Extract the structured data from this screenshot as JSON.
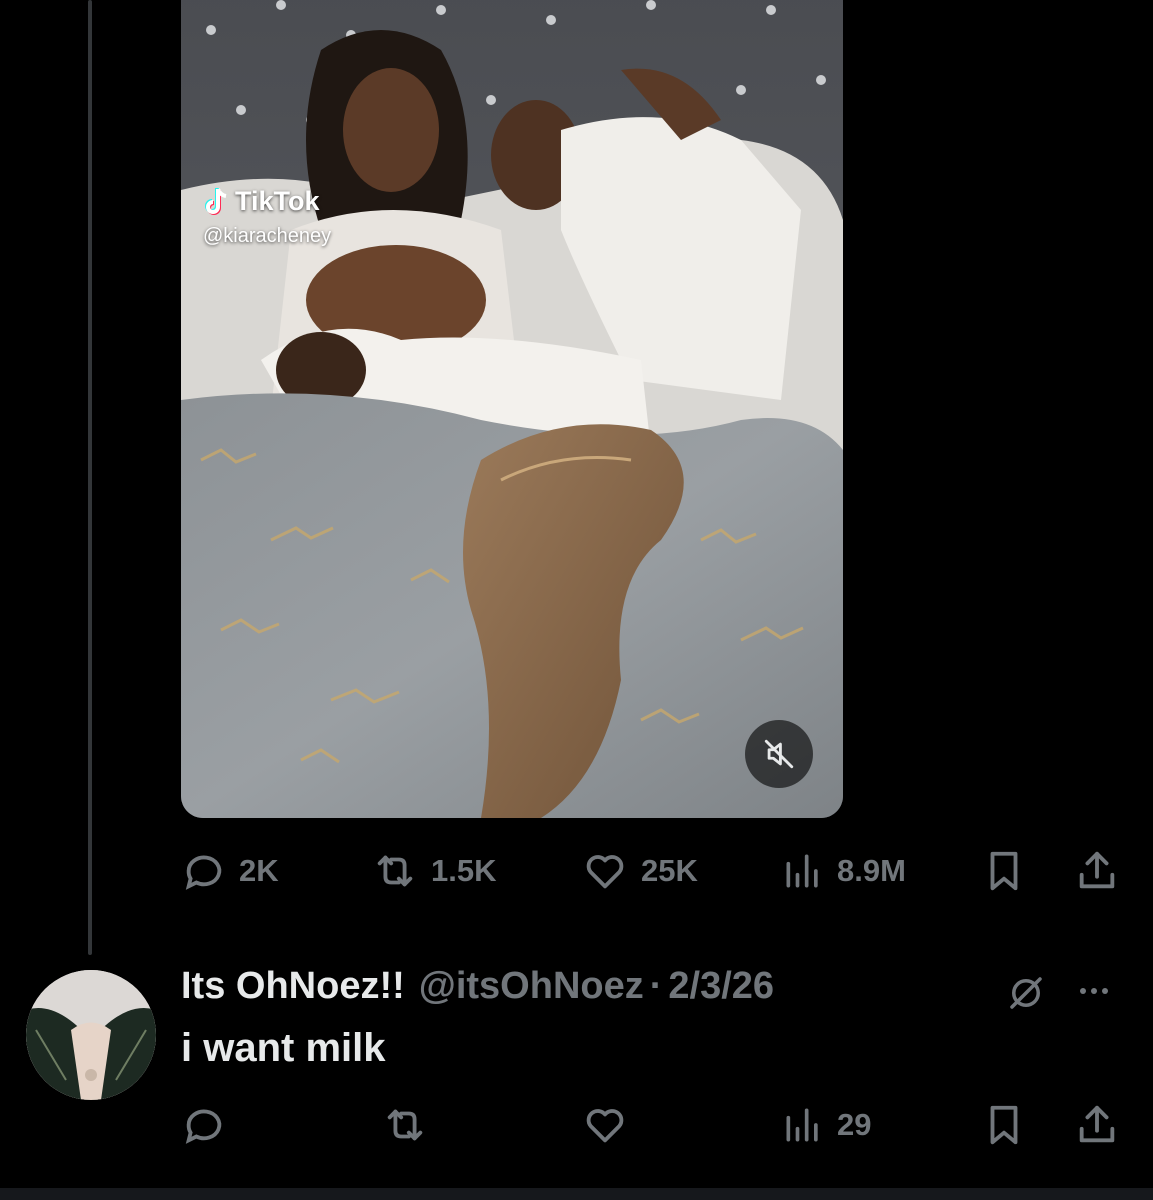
{
  "video": {
    "brand": "TikTok",
    "handle": "@kiaracheney"
  },
  "main_actions": {
    "replies": "2K",
    "reposts": "1.5K",
    "likes": "25K",
    "views": "8.9M"
  },
  "reply": {
    "display_name": "Its OhNoez!!",
    "handle": "@itsOhNoez",
    "separator": "·",
    "date": "2/3/26",
    "text": "i want milk",
    "actions": {
      "views": "29"
    }
  },
  "colors": {
    "background": "#000000",
    "text_primary": "#e7e9ea",
    "text_secondary": "#71767b",
    "thread_line": "#333639"
  }
}
